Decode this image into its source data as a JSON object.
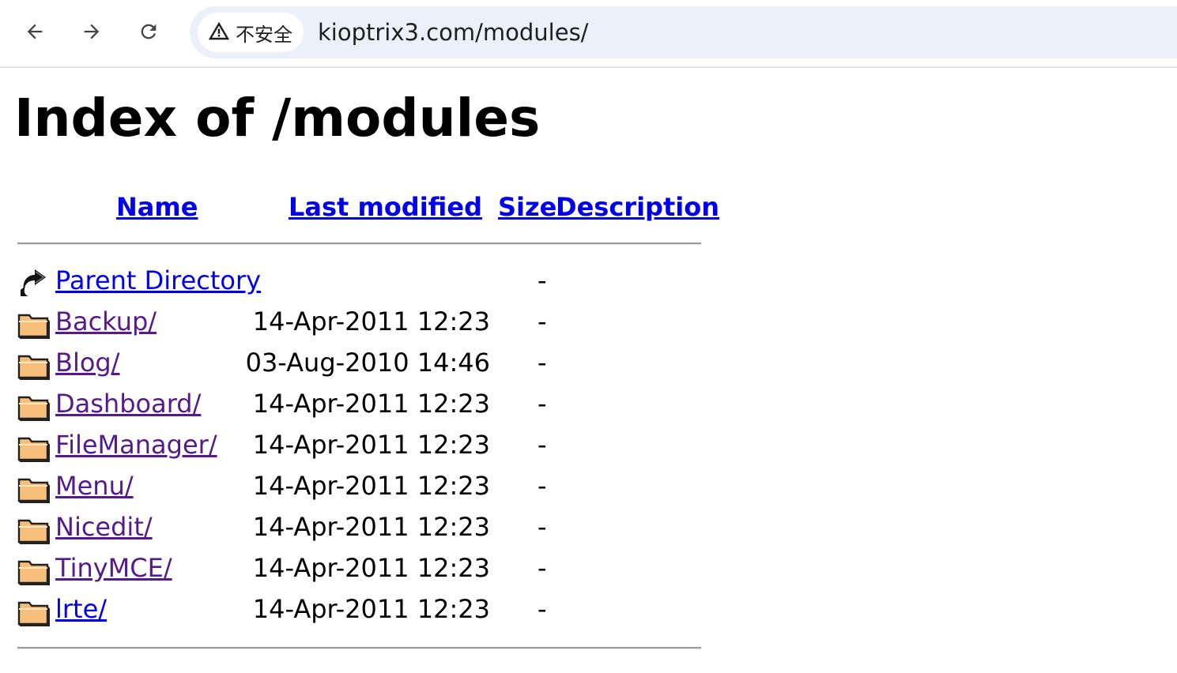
{
  "browser": {
    "nav": {
      "back_icon": "arrow-left-icon",
      "forward_icon": "arrow-right-icon",
      "reload_icon": "reload-icon"
    },
    "security": {
      "icon": "warning-triangle-icon",
      "label": "不安全"
    },
    "url": "kioptrix3.com/modules/"
  },
  "page": {
    "title": "Index of /modules",
    "columns": {
      "name": "Name",
      "last_modified": "Last modified",
      "size": "Size",
      "description": "Description"
    },
    "rows": [
      {
        "icon": "parent-directory-icon",
        "name": "Parent Directory",
        "modified": "",
        "size": "-",
        "visited": false
      },
      {
        "icon": "folder-icon",
        "name": "Backup/",
        "modified": "14-Apr-2011 12:23",
        "size": "-",
        "visited": true
      },
      {
        "icon": "folder-icon",
        "name": "Blog/",
        "modified": "03-Aug-2010 14:46",
        "size": "-",
        "visited": true
      },
      {
        "icon": "folder-icon",
        "name": "Dashboard/",
        "modified": "14-Apr-2011 12:23",
        "size": "-",
        "visited": true
      },
      {
        "icon": "folder-icon",
        "name": "FileManager/",
        "modified": "14-Apr-2011 12:23",
        "size": "-",
        "visited": true
      },
      {
        "icon": "folder-icon",
        "name": "Menu/",
        "modified": "14-Apr-2011 12:23",
        "size": "-",
        "visited": true
      },
      {
        "icon": "folder-icon",
        "name": "Nicedit/",
        "modified": "14-Apr-2011 12:23",
        "size": "-",
        "visited": true
      },
      {
        "icon": "folder-icon",
        "name": "TinyMCE/",
        "modified": "14-Apr-2011 12:23",
        "size": "-",
        "visited": true
      },
      {
        "icon": "folder-icon",
        "name": "lrte/",
        "modified": "14-Apr-2011 12:23",
        "size": "-",
        "visited": false
      }
    ]
  },
  "colors": {
    "link": "#0000ee",
    "visited_link": "#551a8b",
    "omnibox_bg": "#ebf0fa"
  }
}
